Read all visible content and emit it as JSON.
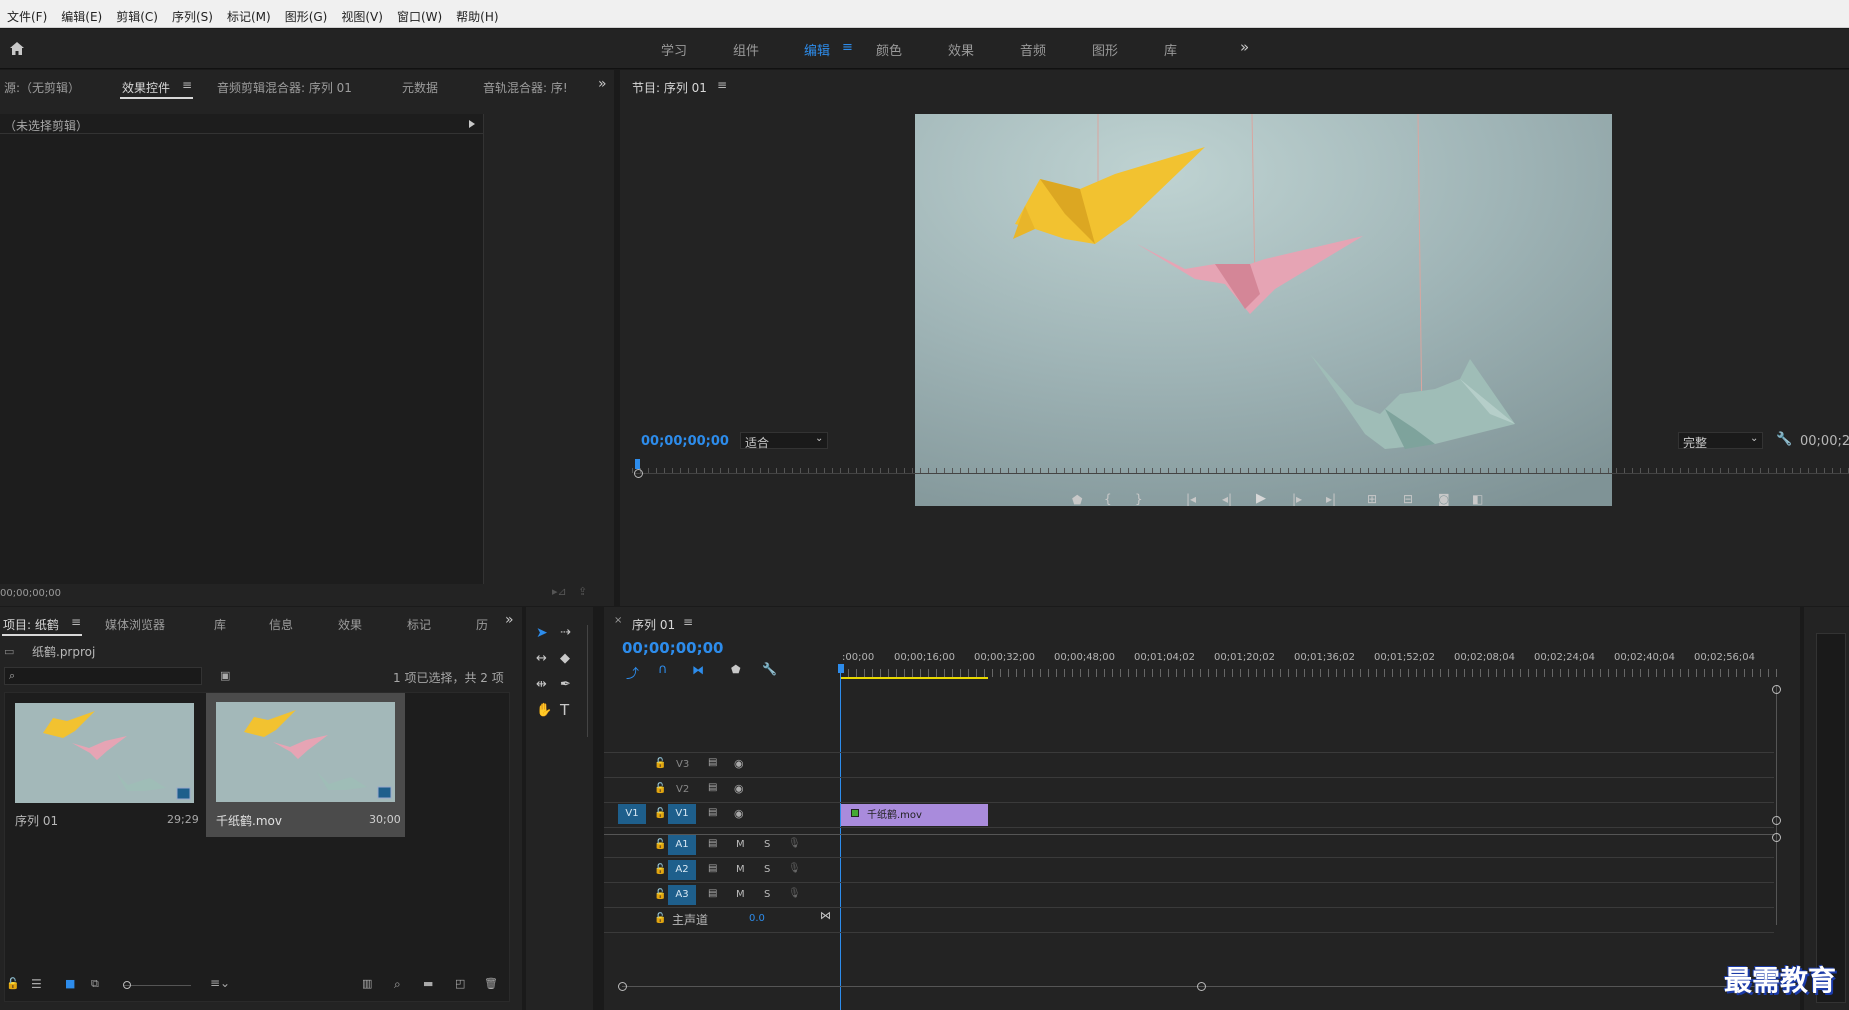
{
  "menubar": {
    "items": [
      "文件(F)",
      "编辑(E)",
      "剪辑(C)",
      "序列(S)",
      "标记(M)",
      "图形(G)",
      "视图(V)",
      "窗口(W)",
      "帮助(H)"
    ]
  },
  "workspace": {
    "tabs": [
      "学习",
      "组件",
      "编辑",
      "颜色",
      "效果",
      "音频",
      "图形",
      "库"
    ],
    "active": "编辑"
  },
  "source_panel": {
    "tabs": [
      "源:（无剪辑）",
      "效果控件",
      "音频剪辑混合器: 序列 01",
      "元数据",
      "音轨混合器: 序!"
    ],
    "no_clip_text": "（未选择剪辑）",
    "timecode": "00;00;00;00"
  },
  "program_monitor": {
    "title": "节目: 序列 01",
    "timecode": "00;00;00;00",
    "fit_label": "适合",
    "quality_label": "完整",
    "end_timecode": "00;00;2"
  },
  "project_panel": {
    "tabs": [
      "项目: 纸鹤",
      "媒体浏览器",
      "库",
      "信息",
      "效果",
      "标记",
      "历"
    ],
    "project_file": "纸鹤.prproj",
    "selection_info": "1 项已选择，共 2 项",
    "items": [
      {
        "name": "序列 01",
        "duration": "29;29"
      },
      {
        "name": "千纸鹤.mov",
        "duration": "30;00"
      }
    ]
  },
  "timeline": {
    "tab": "序列 01",
    "timecode": "00;00;00;00",
    "ruler": [
      ":00;00",
      "00;00;16;00",
      "00;00;32;00",
      "00;00;48;00",
      "00;01;04;02",
      "00;01;20;02",
      "00;01;36;02",
      "00;01;52;02",
      "00;02;08;04",
      "00;02;24;04",
      "00;02;40;04",
      "00;02;56;04"
    ],
    "video_tracks": [
      "V3",
      "V2",
      "V1"
    ],
    "audio_tracks": [
      "A1",
      "A2",
      "A3"
    ],
    "source_patch_v": "V1",
    "mute_label": "M",
    "solo_label": "S",
    "master_label": "主声道",
    "master_value": "0.0",
    "clip_name": "千纸鹤.mov"
  },
  "watermark": "最需教育",
  "colors": {
    "accent": "#2d8ceb",
    "clip": "#a98bdc",
    "track_button": "#1e5f8c",
    "work_area": "#e8d800"
  }
}
